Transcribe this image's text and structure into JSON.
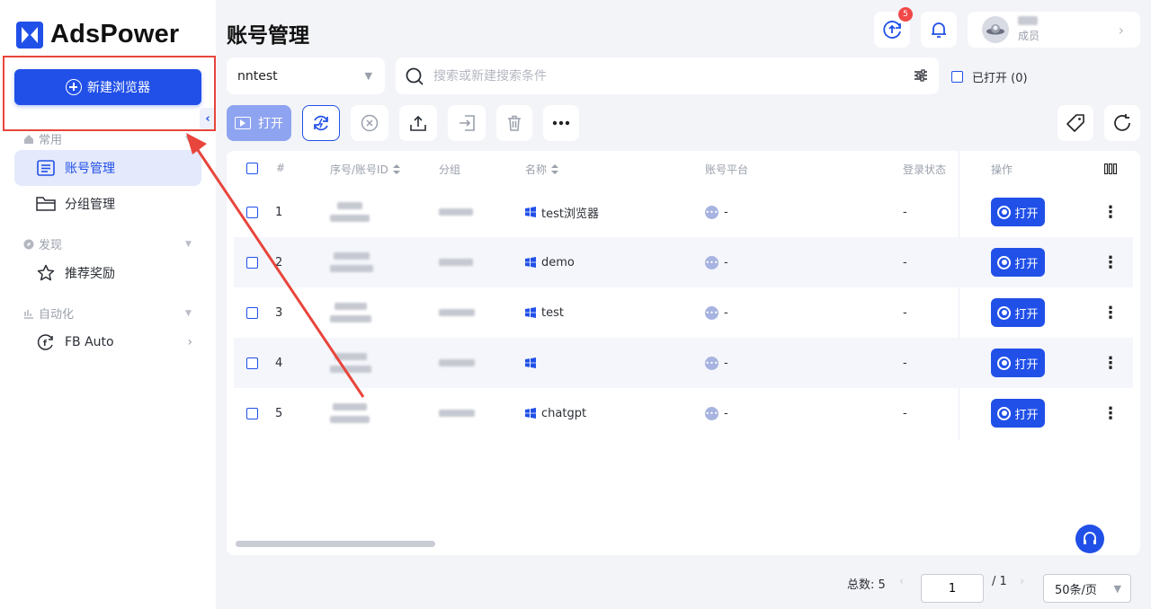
{
  "app": {
    "logo_text": "AdsPower"
  },
  "sidebar": {
    "new_browser_label": "新建浏览器",
    "sections": [
      {
        "label": "常用",
        "items": [
          {
            "label": "账号管理",
            "active": true
          },
          {
            "label": "分组管理"
          }
        ]
      },
      {
        "label": "发现",
        "items": [
          {
            "label": "推荐奖励"
          }
        ]
      },
      {
        "label": "自动化",
        "items": [
          {
            "label": "FB Auto"
          }
        ]
      }
    ]
  },
  "header": {
    "page_title": "账号管理",
    "update_badge": "5",
    "user_role": "成员"
  },
  "filters": {
    "group_value": "nntest",
    "search_placeholder": "搜索或新建搜索条件",
    "opened_label": "已打开 (0)"
  },
  "toolbar": {
    "open_label": "打开"
  },
  "table": {
    "columns": [
      "#",
      "序号/账号ID",
      "分组",
      "名称",
      "账号平台",
      "登录状态",
      "操作"
    ],
    "rows": [
      {
        "index": "1",
        "name": "test浏览器",
        "platform": "-",
        "login": "-",
        "action": "打开"
      },
      {
        "index": "2",
        "name": "demo",
        "platform": "-",
        "login": "-",
        "action": "打开"
      },
      {
        "index": "3",
        "name": "test",
        "platform": "-",
        "login": "-",
        "action": "打开"
      },
      {
        "index": "4",
        "name": "",
        "platform": "-",
        "login": "-",
        "action": "打开"
      },
      {
        "index": "5",
        "name": "chatgpt",
        "platform": "-",
        "login": "-",
        "action": "打开"
      }
    ]
  },
  "pagination": {
    "total_label": "总数: 5",
    "current_page": "1",
    "page_total": "/ 1",
    "per_page": "50条/页"
  },
  "colors": {
    "primary": "#2150e8",
    "annotation": "#e8453c"
  }
}
